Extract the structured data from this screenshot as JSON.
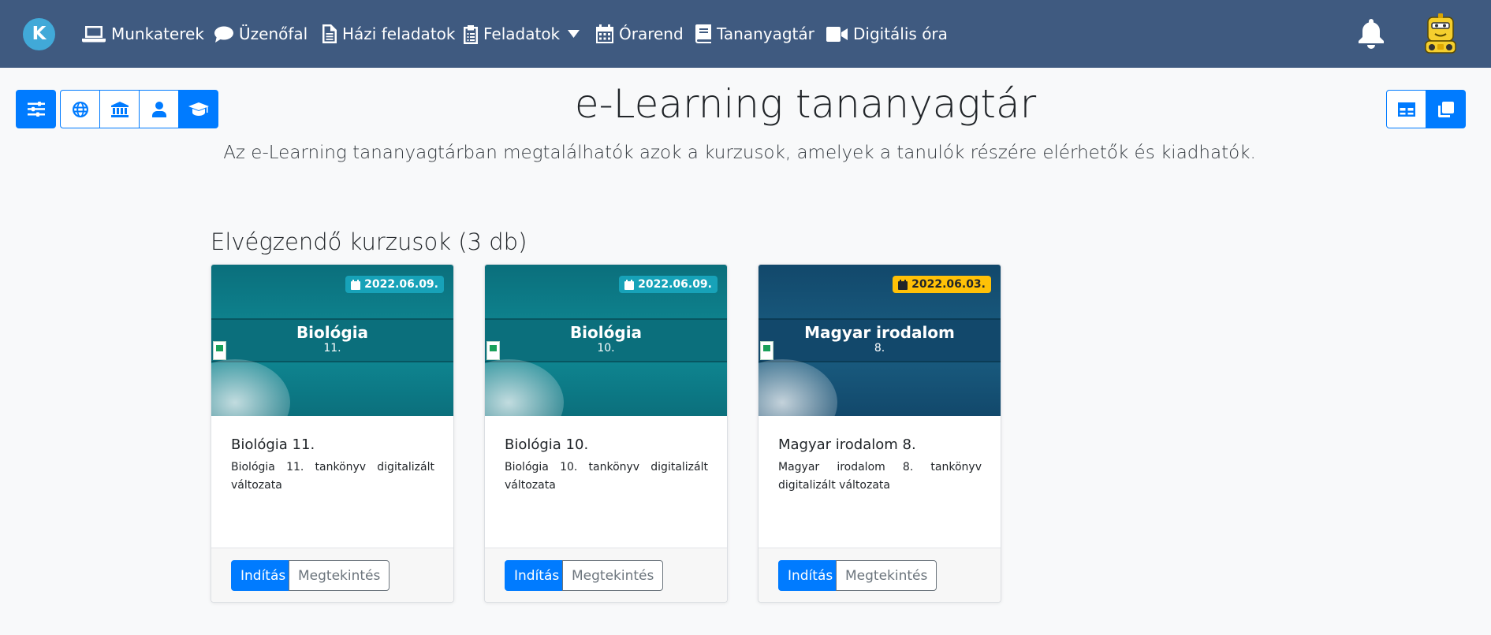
{
  "app": {
    "logo_letter": "K",
    "nav": [
      {
        "label": "Munkaterek",
        "icon": "laptop-icon"
      },
      {
        "label": "Üzenőfal",
        "icon": "comment-icon"
      },
      {
        "label": "Házi feladatok",
        "icon": "file-icon"
      },
      {
        "label": "Feladatok",
        "icon": "clipboard-icon",
        "has_dropdown": true
      },
      {
        "label": "Órarend",
        "icon": "calendar-icon"
      },
      {
        "label": "Tananyagtár",
        "icon": "book-icon"
      },
      {
        "label": "Digitális óra",
        "icon": "video-camera-icon"
      }
    ]
  },
  "toolbar": {
    "left": [
      "sliders-icon",
      "globe-icon",
      "institution-icon",
      "user-icon",
      "graduation-cap-icon"
    ],
    "right": [
      "grid-view-icon",
      "card-view-icon"
    ]
  },
  "page": {
    "title": "e-Learning tananyagtár",
    "subtitle": "Az e-Learning tananyagtárban megtalálhatók azok a kurzusok, amelyek a tanulók részére elérhetők és kiadhatók."
  },
  "section": {
    "title": "Elvégzendő kurzusok (3 db)"
  },
  "courses": [
    {
      "image_title": "Biológia",
      "image_sub": "11.",
      "date": "2022.06.09.",
      "badge_type": "info",
      "name": "Biológia 11.",
      "description": "Biológia 11. tankönyv digitalizált változata",
      "start_label": "Indítás",
      "view_label": "Megtekintés",
      "color_top": "#0b6f7c",
      "color_bottom": "#0f8a95"
    },
    {
      "image_title": "Biológia",
      "image_sub": "10.",
      "date": "2022.06.09.",
      "badge_type": "info",
      "name": "Biológia 10.",
      "description": "Biológia 10. tankönyv digitalizált változata",
      "start_label": "Indítás",
      "view_label": "Megtekintés",
      "color_top": "#0b6f7c",
      "color_bottom": "#0f8a95"
    },
    {
      "image_title": "Magyar irodalom",
      "image_sub": "8.",
      "date": "2022.06.03.",
      "badge_type": "warn",
      "name": "Magyar irodalom 8.",
      "description": "Magyar irodalom 8. tankönyv digitalizált változata",
      "start_label": "Indítás",
      "view_label": "Megtekintés",
      "color_top": "#12486b",
      "color_bottom": "#1a5e82"
    }
  ],
  "colors": {
    "navbar": "#3f5a80",
    "primary": "#007bff",
    "info": "#17a2b8",
    "warning": "#ffc107"
  }
}
